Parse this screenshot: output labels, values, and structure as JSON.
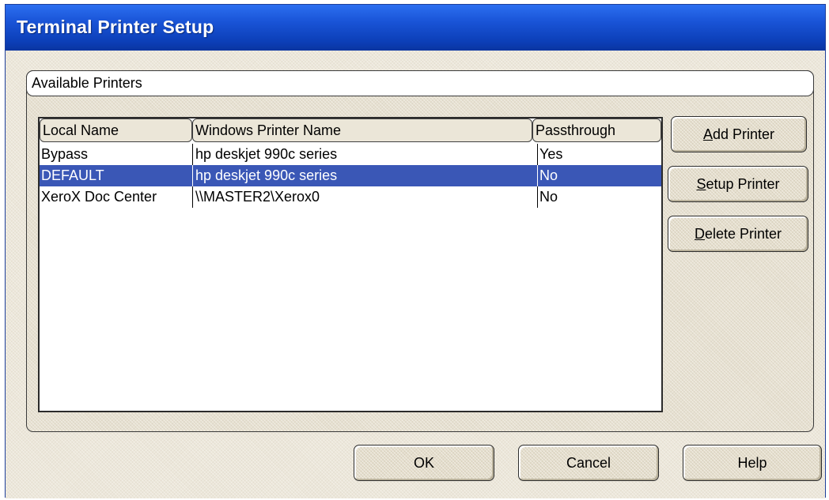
{
  "window": {
    "title": "Terminal Printer Setup"
  },
  "group": {
    "label": "Available Printers"
  },
  "list": {
    "columns": [
      "Local Name",
      "Windows Printer Name",
      "Passthrough"
    ],
    "rows": [
      {
        "local": "Bypass",
        "printer": "hp deskjet 990c series",
        "passthrough": "Yes",
        "selected": false
      },
      {
        "local": "DEFAULT",
        "printer": "hp deskjet 990c series",
        "passthrough": "No",
        "selected": true
      },
      {
        "local": "XeroX Doc Center",
        "printer": "\\\\MASTER2\\Xerox0",
        "passthrough": "No",
        "selected": false
      }
    ]
  },
  "buttons": {
    "add": {
      "mnemonic": "A",
      "rest": "dd Printer"
    },
    "setup": {
      "mnemonic": "S",
      "rest": "etup Printer"
    },
    "delete": {
      "mnemonic": "D",
      "rest": "elete Printer"
    },
    "ok": "OK",
    "cancel": "Cancel",
    "help": "Help"
  },
  "colors": {
    "titlebar": "#0c3fb8",
    "selection": "#3a57b6",
    "face": "#ece7da"
  }
}
